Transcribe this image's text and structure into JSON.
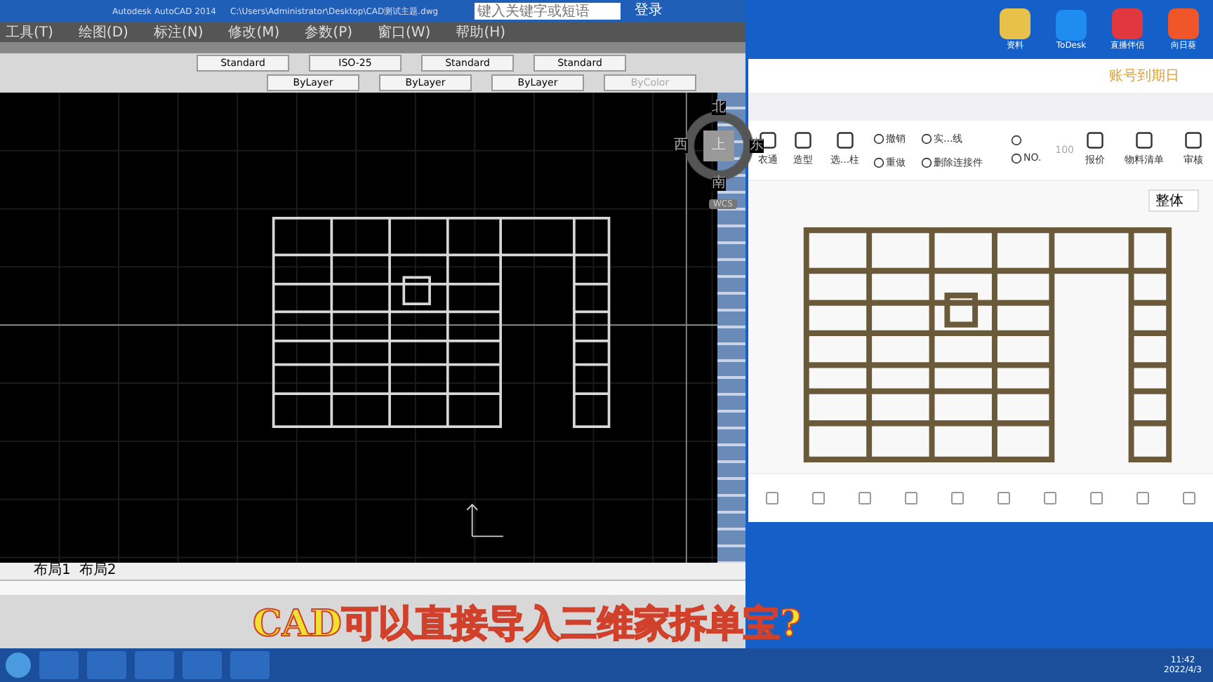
{
  "cad": {
    "title": "Autodesk AutoCAD 2014",
    "file_path": "C:\\Users\\Administrator\\Desktop\\CAD测试主题.dwg",
    "search": {
      "placeholder": "键入关键字或短语"
    },
    "sign_in": "登录",
    "menus": [
      "工具(T)",
      "绘图(D)",
      "标注(N)",
      "修改(M)",
      "参数(P)",
      "窗口(W)",
      "帮助(H)"
    ],
    "style_dropdowns": [
      "Standard",
      "ISO-25",
      "Standard",
      "Standard"
    ],
    "layer_dropdowns": [
      "ByLayer",
      "ByLayer",
      "ByLayer",
      "ByColor"
    ],
    "compass": {
      "north": "北",
      "south": "南",
      "east": "东",
      "west": "西",
      "top": "上",
      "wcs": "WCS"
    },
    "layout_tabs": [
      "布局1",
      "布局2"
    ]
  },
  "desktop_icons": [
    {
      "kind": "folder",
      "label": "资料"
    },
    {
      "kind": "todesk",
      "label": "ToDesk"
    },
    {
      "kind": "live",
      "label": "直播伴侣"
    },
    {
      "kind": "sunflower",
      "label": "向日葵"
    }
  ],
  "app": {
    "expiry_notice": "账号到期日",
    "tools": [
      {
        "kind": "big",
        "label": "衣通"
      },
      {
        "kind": "big",
        "label": "造型"
      },
      {
        "kind": "big",
        "label": "选...柱"
      },
      {
        "kind": "pair",
        "label": "撤销",
        "label2": "重做"
      },
      {
        "kind": "pair",
        "label": "实...线",
        "label2": "删除连接件"
      },
      {
        "kind": "pair",
        "label2": "NO."
      },
      {
        "kind": "value",
        "label": "100"
      },
      {
        "kind": "big",
        "label": "报价"
      },
      {
        "kind": "big",
        "label": "物料清单"
      },
      {
        "kind": "big",
        "label": "审核"
      }
    ],
    "view_dropdown": "整体"
  },
  "caption": "CAD可以直接导入三维家拆单宝?",
  "clock": {
    "time": "11:42",
    "date": "2022/4/3"
  }
}
